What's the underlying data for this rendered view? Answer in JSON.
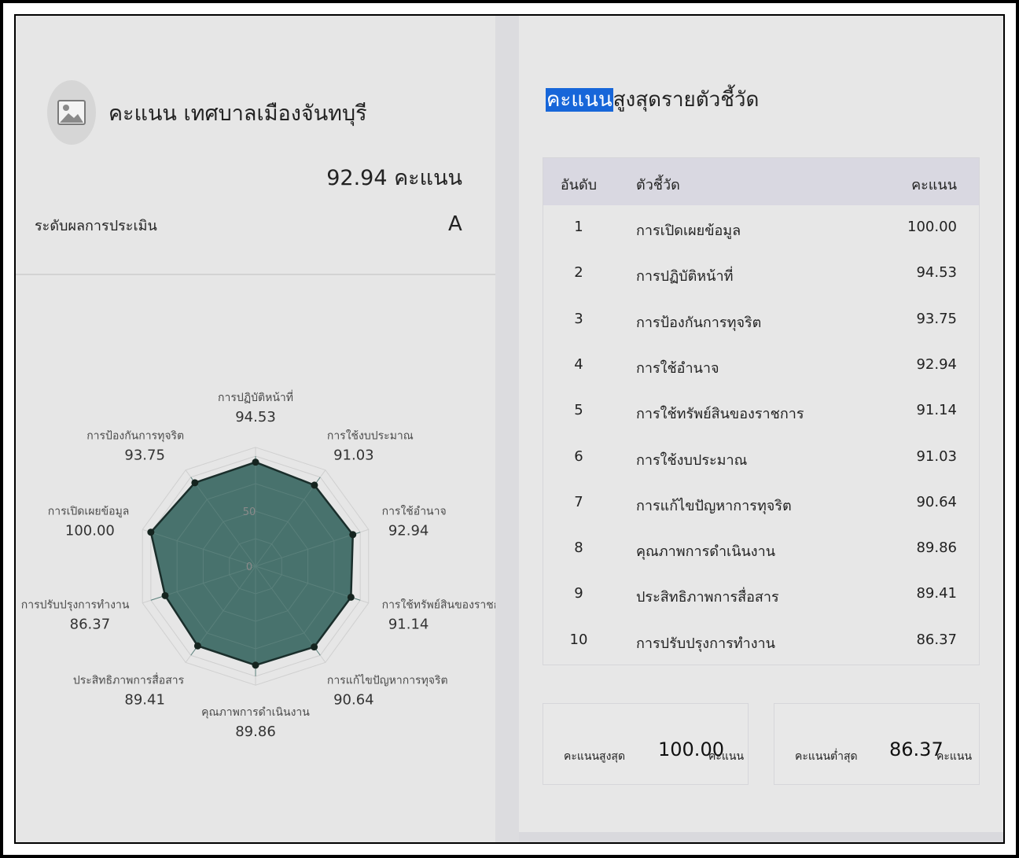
{
  "summary": {
    "org_title": "คะแนน เทศบาลเมืองจันทบุรี",
    "total_score_text": "92.94 คะแนน",
    "grade_label": "ระดับผลการประเมิน",
    "grade": "A",
    "image_icon": "image-placeholder-icon"
  },
  "ranking": {
    "heading_highlight": "คะแนน",
    "heading_rest": "สูงสุดรายตัวชี้วัด",
    "columns": {
      "rank": "อันดับ",
      "indicator": "ตัวชี้วัด",
      "score": "คะแนน"
    },
    "rows": [
      {
        "rank": "1",
        "indicator": "การเปิดเผยข้อมูล",
        "score": "100.00"
      },
      {
        "rank": "2",
        "indicator": "การปฏิบัติหน้าที่",
        "score": "94.53"
      },
      {
        "rank": "3",
        "indicator": "การป้องกันการทุจริต",
        "score": "93.75"
      },
      {
        "rank": "4",
        "indicator": "การใช้อำนาจ",
        "score": "92.94"
      },
      {
        "rank": "5",
        "indicator": "การใช้ทรัพย์สินของราชการ",
        "score": "91.14"
      },
      {
        "rank": "6",
        "indicator": "การใช้งบประมาณ",
        "score": "91.03"
      },
      {
        "rank": "7",
        "indicator": "การแก้ไขปัญหาการทุจริต",
        "score": "90.64"
      },
      {
        "rank": "8",
        "indicator": "คุณภาพการดำเนินงาน",
        "score": "89.86"
      },
      {
        "rank": "9",
        "indicator": "ประสิทธิภาพการสื่อสาร",
        "score": "89.41"
      },
      {
        "rank": "10",
        "indicator": "การปรับปรุงการทำงาน",
        "score": "86.37"
      }
    ]
  },
  "cards": {
    "max": {
      "label": "คะแนนสูงสุด",
      "value": "100.00",
      "unit": "คะแนน"
    },
    "min": {
      "label": "คะแนนต่ำสุด",
      "value": "86.37",
      "unit": "คะแนน"
    }
  },
  "chart_data": {
    "type": "radar",
    "axes": [
      "การปฏิบัติหน้าที่",
      "การใช้งบประมาณ",
      "การใช้อำนาจ",
      "การใช้ทรัพย์สินของราชก",
      "การแก้ไขปัญหาการทุจริต",
      "คุณภาพการดำเนินงาน",
      "ประสิทธิภาพการสื่อสาร",
      "การปรับปรุงการทำงาน",
      "การเปิดเผยข้อมูล",
      "การป้องกันการทุจริต"
    ],
    "values": [
      94.53,
      91.03,
      92.94,
      91.14,
      90.64,
      89.86,
      89.41,
      86.37,
      100.0,
      93.75
    ],
    "value_labels": [
      "94.53",
      "91.03",
      "92.94",
      "91.14",
      "90.64",
      "89.86",
      "89.41",
      "86.37",
      "100.00",
      "93.75"
    ],
    "scale_ticks": [
      "0",
      "50"
    ],
    "range": [
      0,
      100
    ],
    "fill_color": "#3f6b66",
    "stroke_color": "#1a2e2b",
    "grid": true
  }
}
